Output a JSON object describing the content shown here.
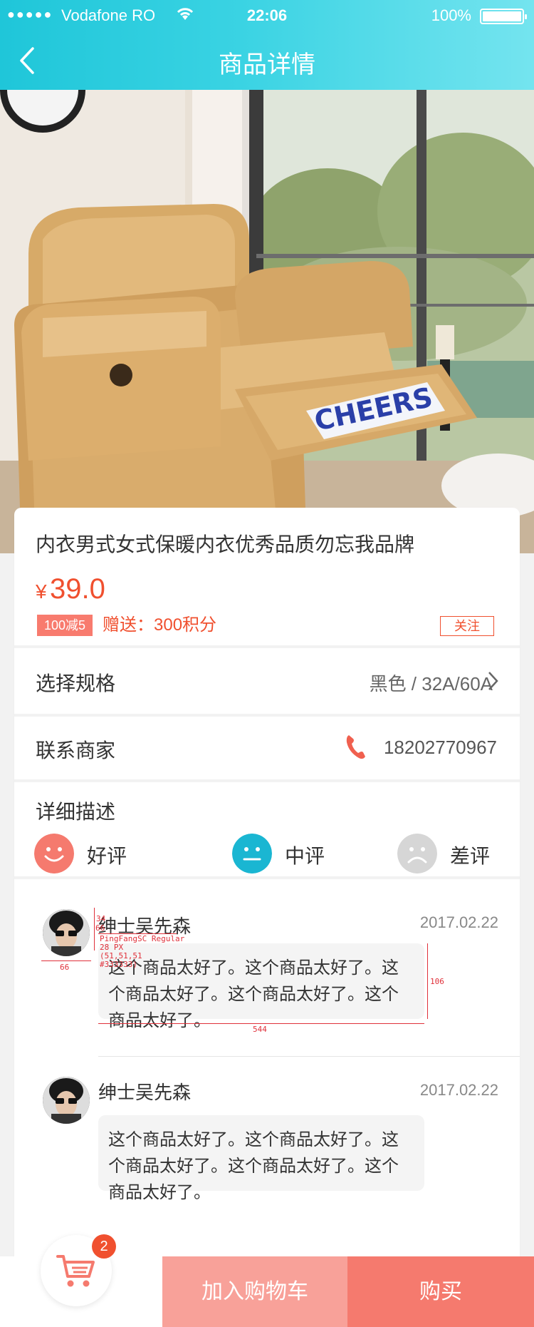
{
  "status_bar": {
    "signal": "●●●●●",
    "carrier": "Vodafone RO",
    "time": "22:06",
    "battery": "100%"
  },
  "nav": {
    "back_icon": "chevron-left-icon",
    "title": "商品详情"
  },
  "hero": {
    "image_text": "CHEERS"
  },
  "product": {
    "title": "内衣男式女式保暖内衣优秀品质勿忘我品牌",
    "currency": "¥",
    "price": "39.0",
    "promo_badge": "100减5",
    "gift_text": "赠送：300积分",
    "follow_label": "关注"
  },
  "spec": {
    "label": "选择规格",
    "value": "黑色 / 32A/60A"
  },
  "contact": {
    "label": "联系商家",
    "phone_icon": "phone-icon",
    "phone": "18202770967"
  },
  "description": {
    "label": "详细描述",
    "ratings": [
      {
        "label": "好评",
        "icon": "smile-icon",
        "color": "#f57a6e"
      },
      {
        "label": "中评",
        "icon": "neutral-face-icon",
        "color": "#1ab6d2"
      },
      {
        "label": "差评",
        "icon": "sad-face-icon",
        "color": "#d6d6d6"
      }
    ]
  },
  "comments": [
    {
      "name": "绅士吴先森",
      "date": "2017.02.22",
      "text": "这个商品太好了。这个商品太好了。这个商品太好了。这个商品太好了。这个商品太好了。"
    },
    {
      "name": "绅士吴先森",
      "date": "2017.02.22",
      "text": "这个商品太好了。这个商品太好了。这个商品太好了。这个商品太好了。这个商品太好了。"
    }
  ],
  "annotations": {
    "avatar_h1": "34",
    "avatar_h2": "66",
    "avatar_w": "66",
    "font_name": "PingFangSC Regular",
    "font_size": "28 PX",
    "font_rgb": "(51,51,51",
    "font_hex": "#333333)",
    "bubble_h": "106",
    "bubble_w": "544"
  },
  "bottom_bar": {
    "cart_icon": "cart-icon",
    "cart_count": "2",
    "add_to_cart": "加入购物车",
    "buy": "购买"
  },
  "colors": {
    "header_start": "#1fc6d9",
    "header_end": "#74e4ef",
    "accent": "#f0502f",
    "add_cart_bg": "#f8a199",
    "buy_bg": "#f57a6e"
  }
}
